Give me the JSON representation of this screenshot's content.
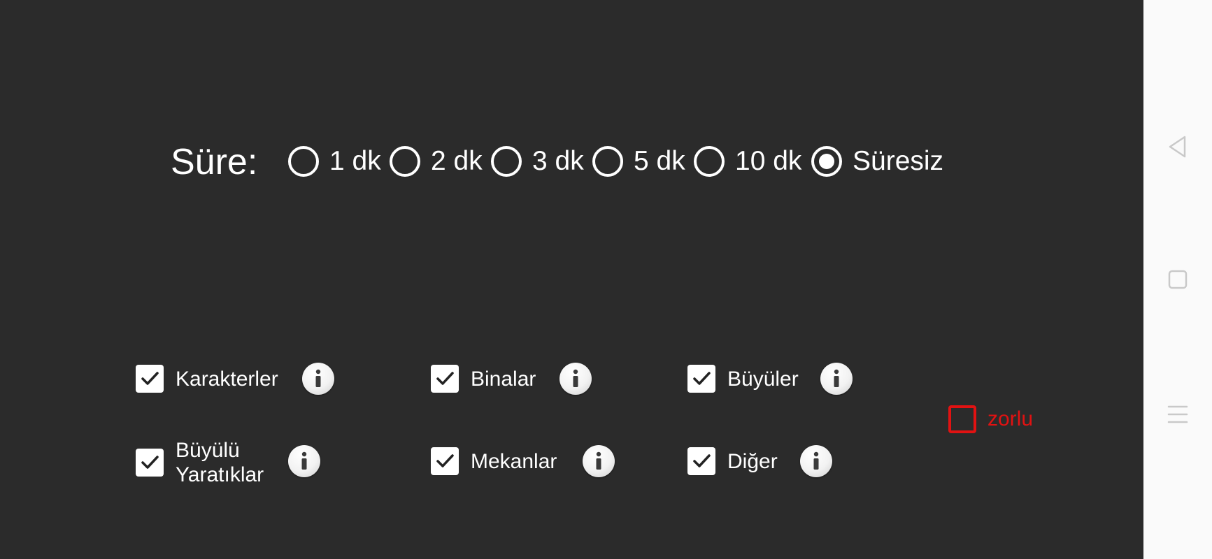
{
  "duration": {
    "label": "Süre:",
    "options": [
      {
        "label": "1 dk",
        "selected": false
      },
      {
        "label": "2 dk",
        "selected": false
      },
      {
        "label": "3 dk",
        "selected": false
      },
      {
        "label": "5 dk",
        "selected": false
      },
      {
        "label": "10 dk",
        "selected": false
      },
      {
        "label": "Süresiz",
        "selected": true
      }
    ]
  },
  "categories": [
    {
      "label": "Karakterler",
      "checked": true
    },
    {
      "label": "Binalar",
      "checked": true
    },
    {
      "label": "Büyüler",
      "checked": true
    },
    {
      "label_line1": "Büyülü",
      "label_line2": "Yaratıklar",
      "checked": true
    },
    {
      "label": "Mekanlar",
      "checked": true
    },
    {
      "label": "Diğer",
      "checked": true
    }
  ],
  "hard_mode": {
    "label": "zorlu",
    "checked": false,
    "color": "#e11212"
  },
  "icons": {
    "info": "info-icon",
    "check": "check-icon",
    "back": "back-icon",
    "home": "home-icon",
    "menu": "menu-icon"
  },
  "colors": {
    "background": "#2b2b2b",
    "navbar": "#fafafa",
    "foreground": "#ffffff",
    "accent_red": "#e11212"
  }
}
